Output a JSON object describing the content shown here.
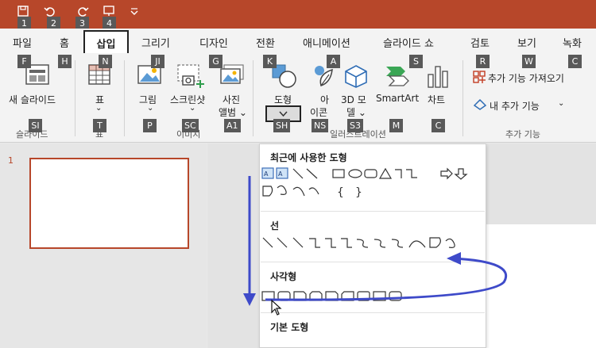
{
  "qat": {
    "keytips": [
      "1",
      "2",
      "3",
      "4"
    ]
  },
  "tabs": [
    {
      "label": "파일",
      "keytip": "F"
    },
    {
      "label": "홈",
      "keytip": "H"
    },
    {
      "label": "삽입",
      "keytip": "N"
    },
    {
      "label": "그리기",
      "keytip": "JI"
    },
    {
      "label": "디자인",
      "keytip": "G"
    },
    {
      "label": "전환",
      "keytip": "K"
    },
    {
      "label": "애니메이션",
      "keytip": "A"
    },
    {
      "label": "슬라이드 쇼",
      "keytip": "S"
    },
    {
      "label": "검토",
      "keytip": "R"
    },
    {
      "label": "보기",
      "keytip": "W"
    },
    {
      "label": "녹화",
      "keytip": "C"
    }
  ],
  "ribbon": {
    "new_slide": {
      "label": "새 슬라이드",
      "keytip": "SI",
      "keytip_top": "SI"
    },
    "table": {
      "label": "표",
      "arrow": "⌄",
      "keytip": "T"
    },
    "picture": {
      "label": "그림",
      "arrow": "⌄",
      "keytip": "P"
    },
    "screenshot": {
      "label": "스크린샷",
      "arrow": "⌄",
      "keytip": "SC"
    },
    "photo_album": {
      "label1": "사진",
      "label2": "앨범 ⌄",
      "keytip": "A1"
    },
    "shapes": {
      "label": "도형",
      "keytip": "SH"
    },
    "icons": {
      "label1": "아",
      "label2": "이콘",
      "keytip": "NS"
    },
    "models": {
      "label1": "3D 모",
      "label2": "델 ⌄",
      "keytip": "S3"
    },
    "smartart": {
      "label": "SmartArt",
      "keytip": "M"
    },
    "chart": {
      "label": "차트",
      "keytip": "C"
    },
    "get_addins": {
      "label": "추가 기능 가져오기"
    },
    "my_addins": {
      "label": "내 추가 기능",
      "arrow": "⌄"
    },
    "groups": {
      "slides": "슬라이드",
      "tables": "표",
      "images": "이미지",
      "illustrations": "일러스트레이션",
      "addins": "추가 기능"
    }
  },
  "thumbnail": {
    "number": "1"
  },
  "dropdown": {
    "sections": {
      "recent": "최근에 사용한 도형",
      "lines": "선",
      "rectangles": "사각형",
      "basic": "기본 도형"
    }
  },
  "colors": {
    "accent": "#b7472a",
    "keytip": "#595959",
    "annotation": "#3e4ac9"
  }
}
